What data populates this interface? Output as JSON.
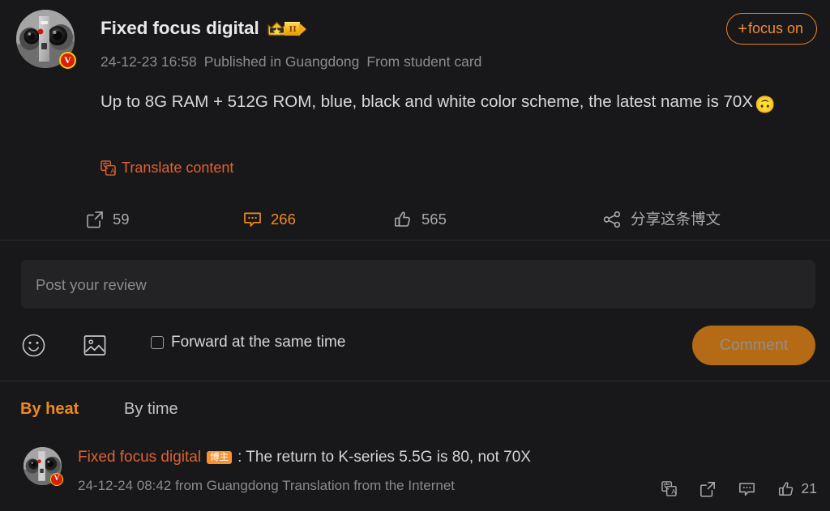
{
  "theme": {
    "background": "#18181a",
    "accent_orange": "#f18a1e",
    "link_orange": "#e0622e",
    "follow_border": "#e8832a",
    "comment_button_bg": "#b56b16",
    "text_primary": "#d8d8da",
    "text_secondary": "#8c8c90",
    "divider": "#2b2b2e",
    "badge_gold": "#f5b21c",
    "verified_red": "#d81e06"
  },
  "post": {
    "author": {
      "name": "Fixed focus digital",
      "avatar_icon": "camera-lens-photo-avatar",
      "verified_mark": "V",
      "level_badge": {
        "crown_icon": "crown-icon",
        "level": "II"
      }
    },
    "follow_button": {
      "plus": "+",
      "label": "focus on"
    },
    "meta": {
      "timestamp": "24-12-23 16:58",
      "location": "Published in Guangdong",
      "source": "From student card"
    },
    "content": {
      "text": "Up to 8G RAM + 512G ROM, blue, black and white color scheme, the latest name is 70X",
      "trailing_emoji": "🙃"
    },
    "translate": {
      "icon": "translate-icon",
      "label": "Translate content"
    },
    "actions": [
      {
        "name": "repost",
        "icon": "repost-icon",
        "count": "59"
      },
      {
        "name": "comment",
        "icon": "comment-icon",
        "count": "266"
      },
      {
        "name": "like",
        "icon": "thumbs-up-icon",
        "count": "565"
      },
      {
        "name": "share",
        "icon": "share-icon",
        "count": "分享这条博文"
      }
    ]
  },
  "composer": {
    "placeholder": "Post your review",
    "value": "",
    "emoji_icon": "smiley-icon",
    "image_icon": "image-icon",
    "forward_checkbox": {
      "label": "Forward at the same time",
      "checked": false
    },
    "submit_button": {
      "label": "Comment",
      "disabled": true
    }
  },
  "comment_sort": {
    "tabs": [
      {
        "label": "By heat",
        "active": true
      },
      {
        "label": "By time",
        "active": false
      }
    ]
  },
  "comments": [
    {
      "author": "Fixed focus digital",
      "author_badge": "博主",
      "avatar_icon": "camera-lens-photo-avatar",
      "verified_mark": "V",
      "text": ": The return to K-series 5.5G is 80, not 70X",
      "timestamp": "24-12-24 08:42",
      "location": "from Guangdong",
      "translation_note": "Translation from the Internet",
      "actions": [
        {
          "name": "translate",
          "icon": "translate-icon",
          "count": ""
        },
        {
          "name": "repost",
          "icon": "repost-icon",
          "count": ""
        },
        {
          "name": "reply",
          "icon": "comment-icon",
          "count": ""
        },
        {
          "name": "like",
          "icon": "thumbs-up-icon",
          "count": "21"
        }
      ]
    }
  ]
}
